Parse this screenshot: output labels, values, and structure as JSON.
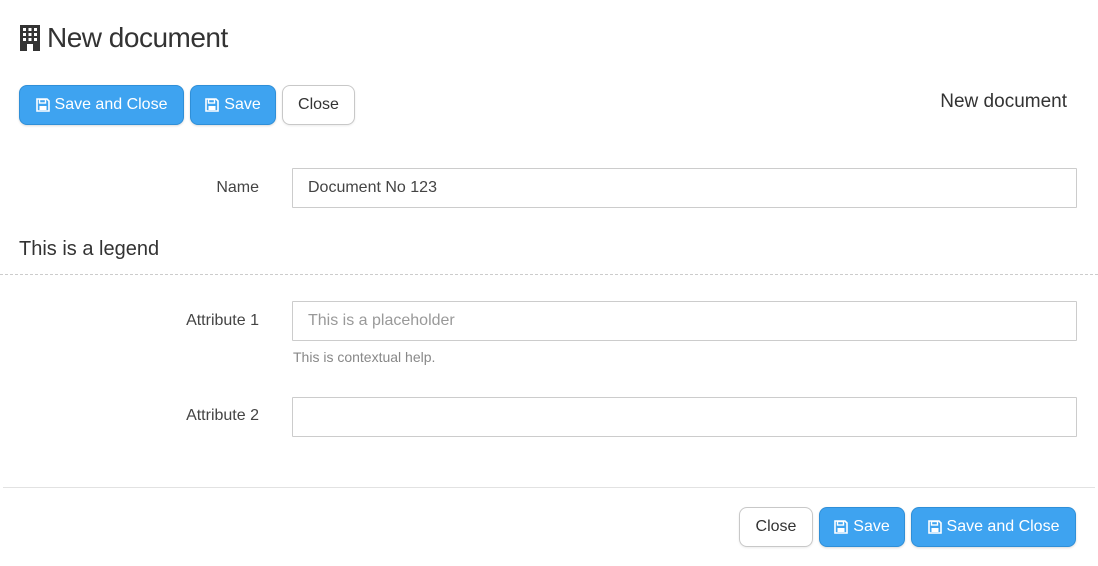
{
  "header": {
    "title": "New document",
    "icon": "building-icon"
  },
  "toolbar": {
    "save_and_close_label": "Save and Close",
    "save_label": "Save",
    "close_label": "Close",
    "document_label": "New document"
  },
  "form": {
    "name": {
      "label": "Name",
      "value": "Document No 123"
    },
    "legend": "This is a legend",
    "attribute1": {
      "label": "Attribute 1",
      "placeholder": "This is a placeholder",
      "help": "This is contextual help."
    },
    "attribute2": {
      "label": "Attribute 2",
      "value": ""
    }
  },
  "footer": {
    "close_label": "Close",
    "save_label": "Save",
    "save_and_close_label": "Save and Close"
  },
  "colors": {
    "primary": "#3ea3f0",
    "primary_border": "#2f8fd8",
    "text": "#333333",
    "muted": "#888888"
  }
}
